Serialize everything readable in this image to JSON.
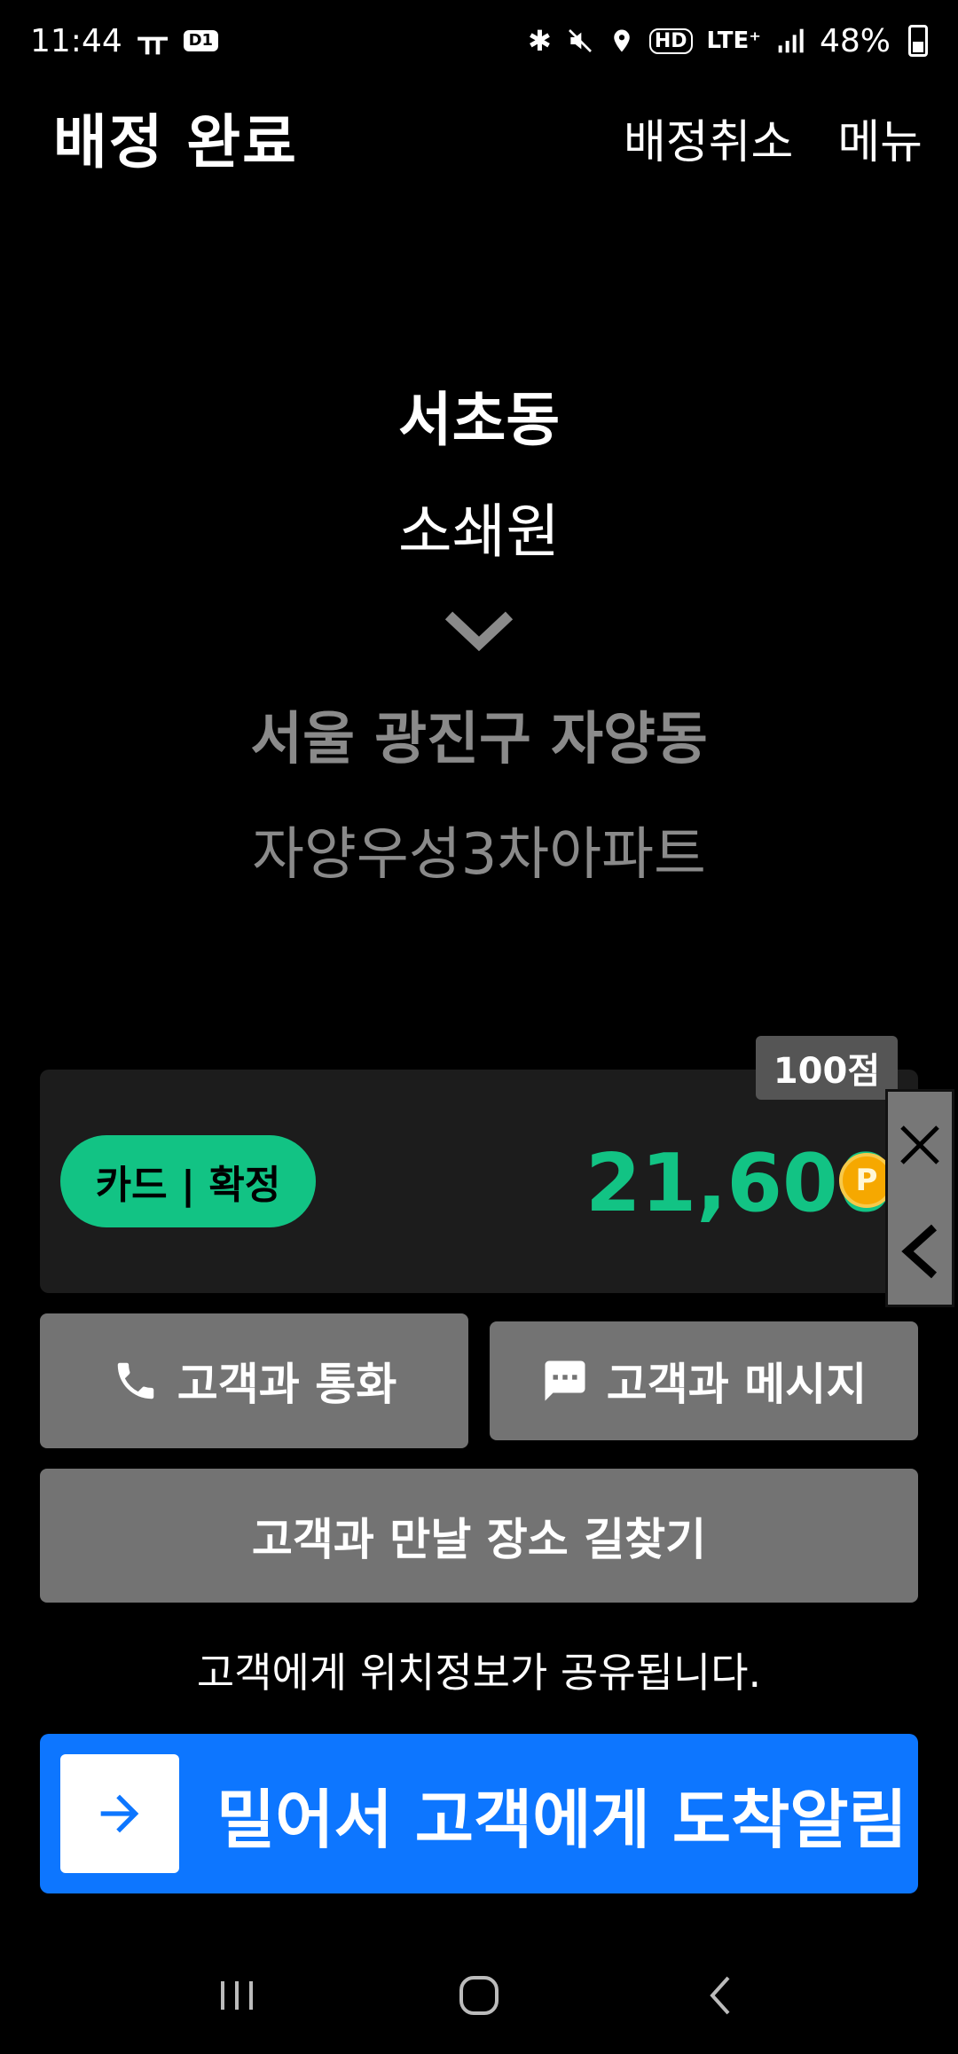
{
  "status_bar": {
    "time": "11:44",
    "tmap_glyph": "ㅠ",
    "d1_badge": "D1",
    "icons": [
      "bluetooth-icon",
      "mute-icon",
      "location-icon",
      "hd-icon",
      "lte-icon",
      "signal-icon",
      "battery-icon"
    ],
    "hd_label": "HD",
    "lte_label": "LTE⁺",
    "battery": "48%"
  },
  "header": {
    "title": "배정 완료",
    "cancel_label": "배정취소",
    "menu_label": "메뉴"
  },
  "route": {
    "origin_area": "서초동",
    "origin_place": "소쇄원",
    "destination_area": "서울 광진구 자양동",
    "destination_place": "자양우성3차아파트"
  },
  "fare": {
    "points": "100점",
    "payment": "카드 | 확정",
    "amount": "21,600",
    "coin_letter": "P"
  },
  "actions": {
    "call_label": "고객과 통화",
    "message_label": "고객과 메시지",
    "directions_label": "고객과 만날 장소 길찾기"
  },
  "notice": "고객에게 위치정보가 공유됩니다.",
  "swipe": {
    "label": "밀어서 고객에게 도착알림"
  },
  "colors": {
    "accent_green": "#12c384",
    "swipe_blue": "#0d76ff",
    "button_gray": "#737373",
    "card_bg": "#1c1c1c"
  }
}
